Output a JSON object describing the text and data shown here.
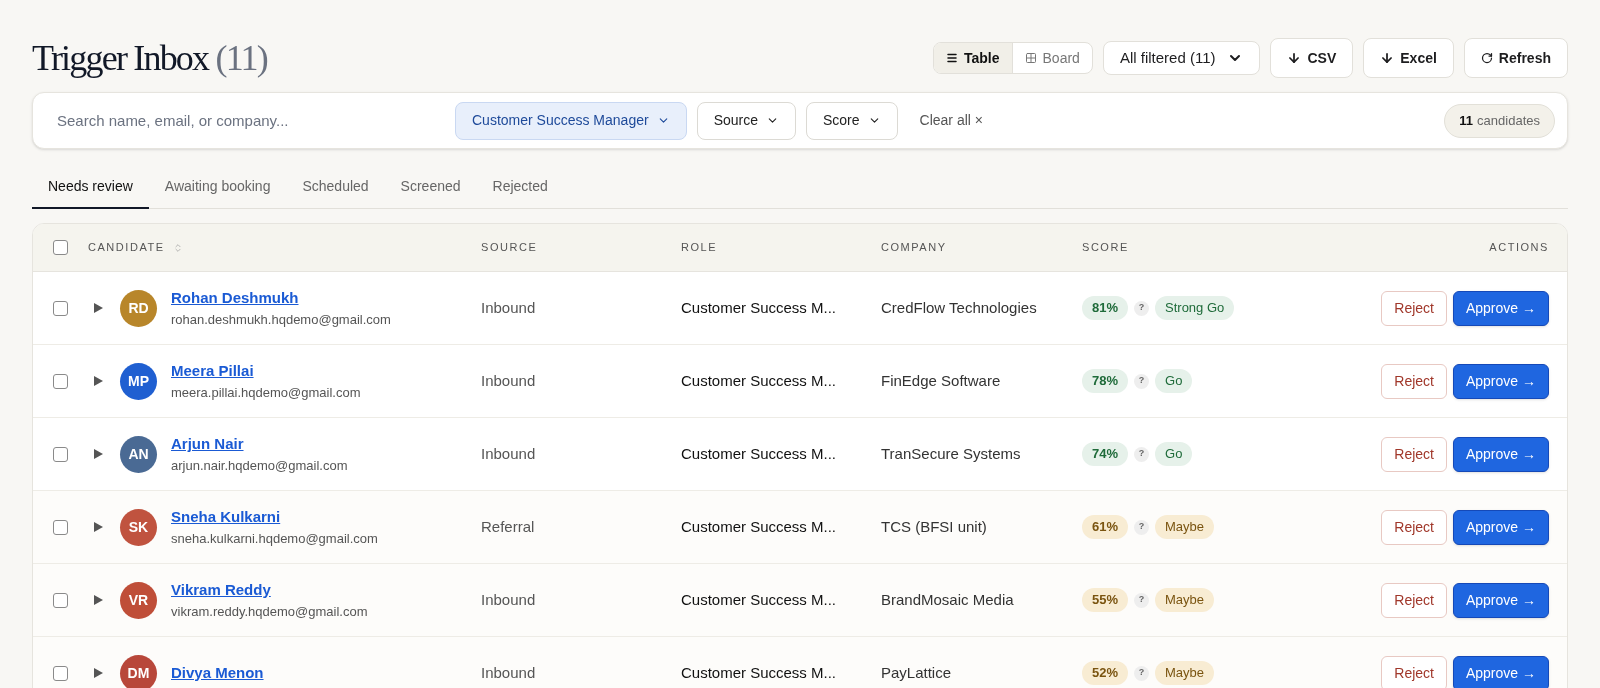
{
  "header": {
    "title": "Trigger Inbox",
    "count": "(11)"
  },
  "view_toggle": [
    {
      "label": "Table",
      "kind": "table",
      "selected": true
    },
    {
      "label": "Board",
      "kind": "board",
      "selected": false
    }
  ],
  "export_select": {
    "value": "All filtered (11)"
  },
  "actions": [
    {
      "label": "CSV",
      "kind": "download"
    },
    {
      "label": "Excel",
      "kind": "download"
    },
    {
      "label": "Refresh",
      "kind": "refresh"
    }
  ],
  "filter_bar": {
    "search": {
      "placeholder": "Search name, email, or company..."
    },
    "filters": [
      {
        "label": "Customer Success Manager",
        "active": true
      },
      {
        "label": "Source",
        "active": false
      },
      {
        "label": "Score",
        "active": false
      }
    ],
    "clear": "Clear all ×",
    "total": {
      "count": "11",
      "label": "candidates"
    }
  },
  "tabs": [
    {
      "label": "Needs review",
      "selected": true
    },
    {
      "label": "Awaiting booking",
      "selected": false
    },
    {
      "label": "Scheduled",
      "selected": false
    },
    {
      "label": "Screened",
      "selected": false
    },
    {
      "label": "Rejected",
      "selected": false
    }
  ],
  "table": {
    "select_all": {
      "checked": false
    },
    "columns": [
      "CANDIDATE",
      "SOURCE",
      "ROLE",
      "COMPANY",
      "SCORE",
      "ACTIONS"
    ],
    "rows": [
      {
        "checked": false,
        "expanded": false,
        "initials": "RD",
        "color": "#b8862a",
        "name": "Rohan Deshmukh",
        "email": "rohan.deshmukh.hqdemo@gmail.com",
        "source": "Inbound",
        "role": "Customer Success M...",
        "company": "CredFlow Technologies",
        "score": "81%",
        "hint": "?",
        "verdict": "Strong Go",
        "kind": "positive",
        "reject": "Reject",
        "approve": "Approve →"
      },
      {
        "checked": false,
        "expanded": false,
        "initials": "MP",
        "color": "#1f5fd1",
        "name": "Meera Pillai",
        "email": "meera.pillai.hqdemo@gmail.com",
        "source": "Inbound",
        "role": "Customer Success M...",
        "company": "FinEdge Software",
        "score": "78%",
        "hint": "?",
        "verdict": "Go",
        "kind": "positive",
        "reject": "Reject",
        "approve": "Approve →"
      },
      {
        "checked": false,
        "expanded": false,
        "initials": "AN",
        "color": "#4a6a94",
        "name": "Arjun Nair",
        "email": "arjun.nair.hqdemo@gmail.com",
        "source": "Inbound",
        "role": "Customer Success M...",
        "company": "TranSecure Systems",
        "score": "74%",
        "hint": "?",
        "verdict": "Go",
        "kind": "positive",
        "reject": "Reject",
        "approve": "Approve →"
      },
      {
        "checked": false,
        "expanded": false,
        "initials": "SK",
        "color": "#c0533f",
        "name": "Sneha Kulkarni",
        "email": "sneha.kulkarni.hqdemo@gmail.com",
        "source": "Referral",
        "role": "Customer Success M...",
        "company": "TCS (BFSI unit)",
        "score": "61%",
        "hint": "?",
        "verdict": "Maybe",
        "kind": "caution",
        "reject": "Reject",
        "approve": "Approve →"
      },
      {
        "checked": false,
        "expanded": false,
        "initials": "VR",
        "color": "#bf4e38",
        "name": "Vikram Reddy",
        "email": "vikram.reddy.hqdemo@gmail.com",
        "source": "Inbound",
        "role": "Customer Success M...",
        "company": "BrandMosaic Media",
        "score": "55%",
        "hint": "?",
        "verdict": "Maybe",
        "kind": "caution",
        "reject": "Reject",
        "approve": "Approve →"
      },
      {
        "checked": false,
        "expanded": false,
        "initials": "DM",
        "color": "#b8473a",
        "name": "Divya Menon",
        "source": "Inbound",
        "role": "Customer Success M...",
        "company": "PayLattice",
        "score": "52%",
        "hint": "?",
        "verdict": "Maybe",
        "kind": "caution",
        "reject": "Reject",
        "approve": "Approve →"
      }
    ]
  }
}
